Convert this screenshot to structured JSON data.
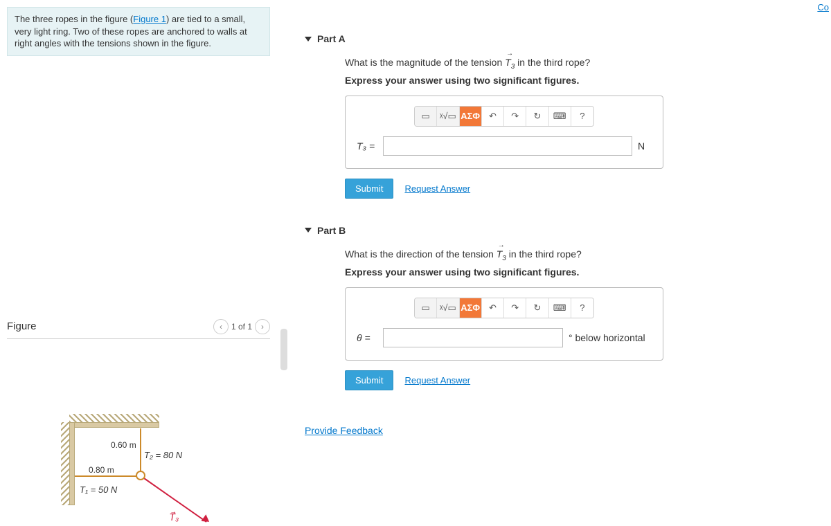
{
  "topLink": "Co",
  "problem": {
    "text_before": "The three ropes in the figure (",
    "figure_link": "Figure 1",
    "text_after": ") are tied to a small, very light ring. Two of these ropes are anchored to walls at right angles with the tensions shown in the figure."
  },
  "figurePanel": {
    "title": "Figure",
    "pager": "1 of 1",
    "labels": {
      "dim1": "0.80 m",
      "dim2": "0.60 m",
      "t1": "T₁  = 50 N",
      "t2": "T₂  = 80 N",
      "t3": "T⃗₃"
    }
  },
  "toolbar": {
    "template_tip": "▭",
    "root_tip": "ᵡ√▭",
    "greek": "ΑΣΦ",
    "undo": "↶",
    "redo": "↷",
    "reset": "↻",
    "keyboard": "⌨",
    "help": "?"
  },
  "partA": {
    "header": "Part A",
    "q1_a": "What is the magnitude of the tension ",
    "q1_b": " in the third rope?",
    "q2": "Express your answer using two significant figures.",
    "label": "T₃ =",
    "unit": "N",
    "submit": "Submit",
    "request": "Request Answer"
  },
  "partB": {
    "header": "Part B",
    "q1_a": "What is the direction of the tension ",
    "q1_b": " in the third rope?",
    "q2": "Express your answer using two significant figures.",
    "label": "θ =",
    "unit": "°  below horizontal",
    "submit": "Submit",
    "request": "Request Answer"
  },
  "feedback": "Provide Feedback"
}
